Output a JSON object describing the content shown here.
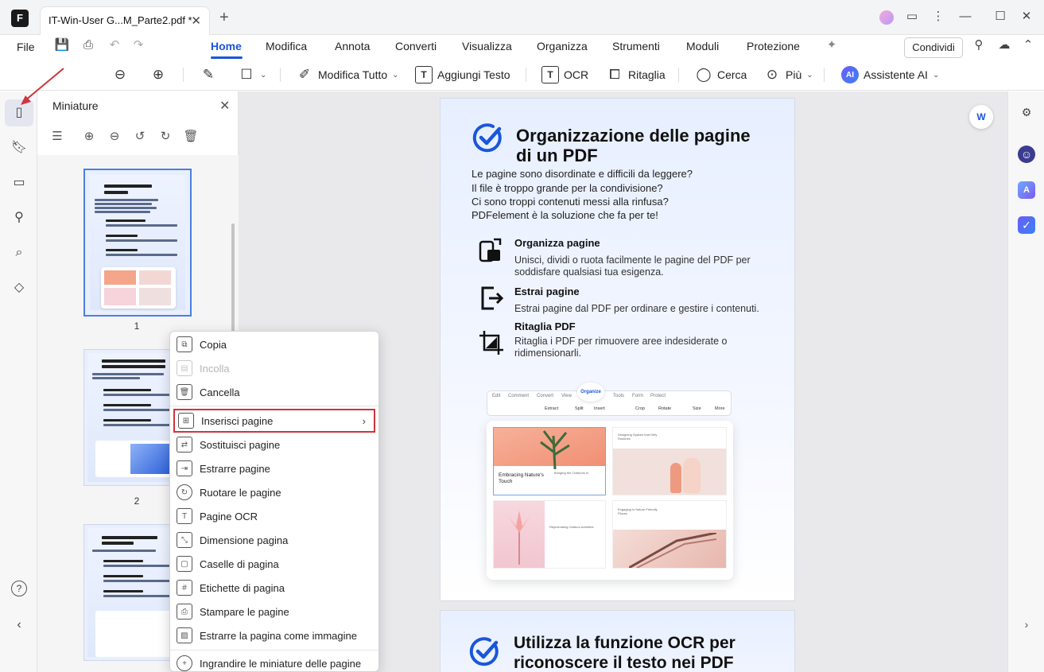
{
  "app": {
    "tab_title": "IT-Win-User  G...M_Parte2.pdf *",
    "logo_letter": "F"
  },
  "menu": {
    "file": "File",
    "tabs": [
      "Home",
      "Modifica",
      "Annota",
      "Converti",
      "Visualizza",
      "Organizza",
      "Strumenti",
      "Moduli",
      "Protezione"
    ],
    "share": "Condividi"
  },
  "toolbar": {
    "modifica_tutto": "Modifica Tutto",
    "aggiungi_testo": "Aggiungi Testo",
    "ocr": "OCR",
    "ritaglia": "Ritaglia",
    "cerca": "Cerca",
    "piu": "Più",
    "assistente": "Assistente AI",
    "ai_badge": "AI"
  },
  "panel": {
    "title": "Miniature",
    "page_numbers": [
      "1",
      "2"
    ]
  },
  "context_menu": {
    "items": [
      {
        "label": "Copia",
        "icon": "copy-icon",
        "disabled": false
      },
      {
        "label": "Incolla",
        "icon": "paste-icon",
        "disabled": true
      },
      {
        "label": "Cancella",
        "icon": "trash-icon",
        "disabled": false
      },
      {
        "label": "Inserisci pagine",
        "icon": "insert-pages-icon",
        "disabled": false,
        "submenu": true,
        "highlighted": true
      },
      {
        "label": "Sostituisci pagine",
        "icon": "replace-pages-icon",
        "disabled": false
      },
      {
        "label": "Estrarre pagine",
        "icon": "extract-pages-icon",
        "disabled": false
      },
      {
        "label": "Ruotare le pagine",
        "icon": "rotate-pages-icon",
        "disabled": false
      },
      {
        "label": "Pagine OCR",
        "icon": "ocr-icon",
        "disabled": false
      },
      {
        "label": "Dimensione pagina",
        "icon": "page-size-icon",
        "disabled": false
      },
      {
        "label": "Caselle di pagina",
        "icon": "page-boxes-icon",
        "disabled": false
      },
      {
        "label": "Etichette di pagina",
        "icon": "page-labels-icon",
        "disabled": false
      },
      {
        "label": "Stampare le pagine",
        "icon": "print-icon",
        "disabled": false
      },
      {
        "label": "Estrarre la pagina come immagine",
        "icon": "image-icon",
        "disabled": false
      },
      {
        "label": "Ingrandire le miniature delle pagine",
        "icon": "zoom-in-icon",
        "disabled": false
      }
    ]
  },
  "page1": {
    "title": "Organizzazione delle pagine di un PDF",
    "intro": [
      "Le pagine sono disordinate e difficili da leggere?",
      "Il file è troppo grande per la condivisione?",
      "Ci sono troppi contenuti messi alla rinfusa?",
      "PDFelement è la soluzione che fa per te!"
    ],
    "features": [
      {
        "title": "Organizza pagine",
        "desc": "Unisci, dividi o ruota facilmente le pagine del PDF per soddisfare qualsiasi tua esigenza."
      },
      {
        "title": "Estrai pagine",
        "desc": "Estrai pagine dal PDF per ordinare e gestire i contenuti."
      },
      {
        "title": "Ritaglia PDF",
        "desc": "Ritaglia i PDF per rimuovere aree indesiderate o ridimensionarli."
      }
    ],
    "illustration": {
      "tabs": [
        "Edit",
        "Comment",
        "Convert",
        "View",
        "Organize",
        "Tools",
        "Form",
        "Protect"
      ],
      "tools": [
        "Extract",
        "Split",
        "Insert",
        "Crop",
        "Rotate",
        "Size",
        "More"
      ],
      "caption_1": "Embracing Nature's Touch",
      "caption_2": "Bringing the Outdoors In",
      "caption_3": "Designing Spaces that Defy Routines",
      "caption_4": "Rejuvenating Outdoor Activities",
      "caption_5": "Engaging in Nature Friendly Places"
    }
  },
  "page2": {
    "title": "Utilizza la funzione OCR per riconoscere il testo nei PDF"
  },
  "right_rail": {
    "translate_label": "W"
  },
  "colors": {
    "accent": "#1a56db",
    "highlight_border": "#d0333d",
    "annotation_arrow": "#d0333d"
  }
}
